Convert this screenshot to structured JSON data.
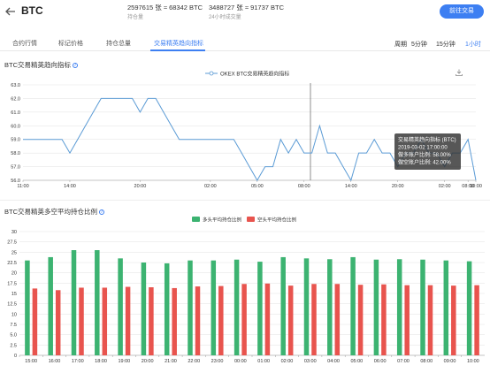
{
  "header": {
    "title": "BTC",
    "open_interest": "2597615 张 ≈ 68342 BTC",
    "open_interest_label": "持仓量",
    "volume_24h": "3488727 张 ≈ 91737 BTC",
    "volume_24h_label": "24小时成交量",
    "trade_button": "前往交易"
  },
  "tabs": [
    {
      "label": "合约行情",
      "active": false
    },
    {
      "label": "标记价格",
      "active": false
    },
    {
      "label": "持仓总量",
      "active": false
    },
    {
      "label": "交易精英趋向指标",
      "active": true
    }
  ],
  "period": {
    "label": "周期",
    "options": [
      {
        "label": "5分钟",
        "active": false
      },
      {
        "label": "15分钟",
        "active": false
      },
      {
        "label": "1小时",
        "active": true
      }
    ]
  },
  "chart1": {
    "section_title": "BTC交易精英趋向指标",
    "tooltip": {
      "title": "交易精英趋向指标 (BTC)",
      "time": "2019-03-02 17:00:00",
      "long_label": "做多账户比例:",
      "long_value": "58.00%",
      "short_label": "做空账户比例:",
      "short_value": "42.00%"
    }
  },
  "chart2": {
    "section_title": "BTC交易精英多空平均持仓比例"
  },
  "chart_data": [
    {
      "type": "line",
      "series": [
        {
          "name": "OKEX BTC交易精英趋向指标",
          "values": [
            59,
            59,
            59,
            59,
            59,
            59,
            58,
            59,
            60,
            61,
            62,
            62,
            62,
            62,
            62,
            61,
            62,
            62,
            61,
            60,
            59,
            59,
            59,
            59,
            59,
            59,
            59,
            59,
            58,
            57,
            56,
            57,
            57,
            59,
            58,
            59,
            58,
            58,
            60,
            58,
            58,
            57,
            56,
            58,
            58,
            59,
            58,
            58,
            57,
            58,
            58,
            59,
            58,
            58,
            57,
            58,
            58,
            59,
            56
          ]
        }
      ],
      "x_tick_labels": [
        "11:00",
        "14:00",
        "20:00",
        "02:00",
        "05:00",
        "08:00",
        "14:00",
        "20:00",
        "02:00",
        "08:00",
        "10:00"
      ],
      "ylim": [
        56.0,
        63.0
      ],
      "y_ticks": [
        "56.0",
        "57.0",
        "58.0",
        "59.0",
        "60.0",
        "61.0",
        "62.0",
        "63.0"
      ],
      "grid": true,
      "legend": "top-center",
      "colors": {
        "line": "#5b9bd5"
      }
    },
    {
      "type": "bar",
      "categories": [
        "15:00",
        "16:00",
        "17:00",
        "18:00",
        "19:00",
        "20:00",
        "21:00",
        "22:00",
        "23:00",
        "00:00",
        "01:00",
        "02:00",
        "03:00",
        "04:00",
        "05:00",
        "06:00",
        "07:00",
        "08:00",
        "09:00",
        "10:00"
      ],
      "series": [
        {
          "name": "多头平均持仓比例",
          "values": [
            23.0,
            23.8,
            25.5,
            25.5,
            23.5,
            22.5,
            22.3,
            23.0,
            23.0,
            23.2,
            22.7,
            23.8,
            23.5,
            23.3,
            23.8,
            23.2,
            23.3,
            23.2,
            23.0,
            22.8
          ]
        },
        {
          "name": "空头平均持仓比例",
          "values": [
            16.2,
            15.8,
            16.4,
            16.4,
            16.6,
            16.5,
            16.3,
            16.7,
            16.8,
            17.3,
            17.4,
            16.9,
            17.3,
            17.3,
            17.1,
            17.2,
            17.0,
            17.0,
            16.9,
            17.0
          ]
        }
      ],
      "ylim": [
        0,
        30
      ],
      "y_ticks": [
        "0",
        "2.5",
        "5.0",
        "7.5",
        "10",
        "12.5",
        "15",
        "17.5",
        "20",
        "22.5",
        "25",
        "27.5",
        "30"
      ],
      "grid": true,
      "legend": "top-center",
      "colors": {
        "long": "#3cb371",
        "short": "#e8544e"
      }
    }
  ]
}
